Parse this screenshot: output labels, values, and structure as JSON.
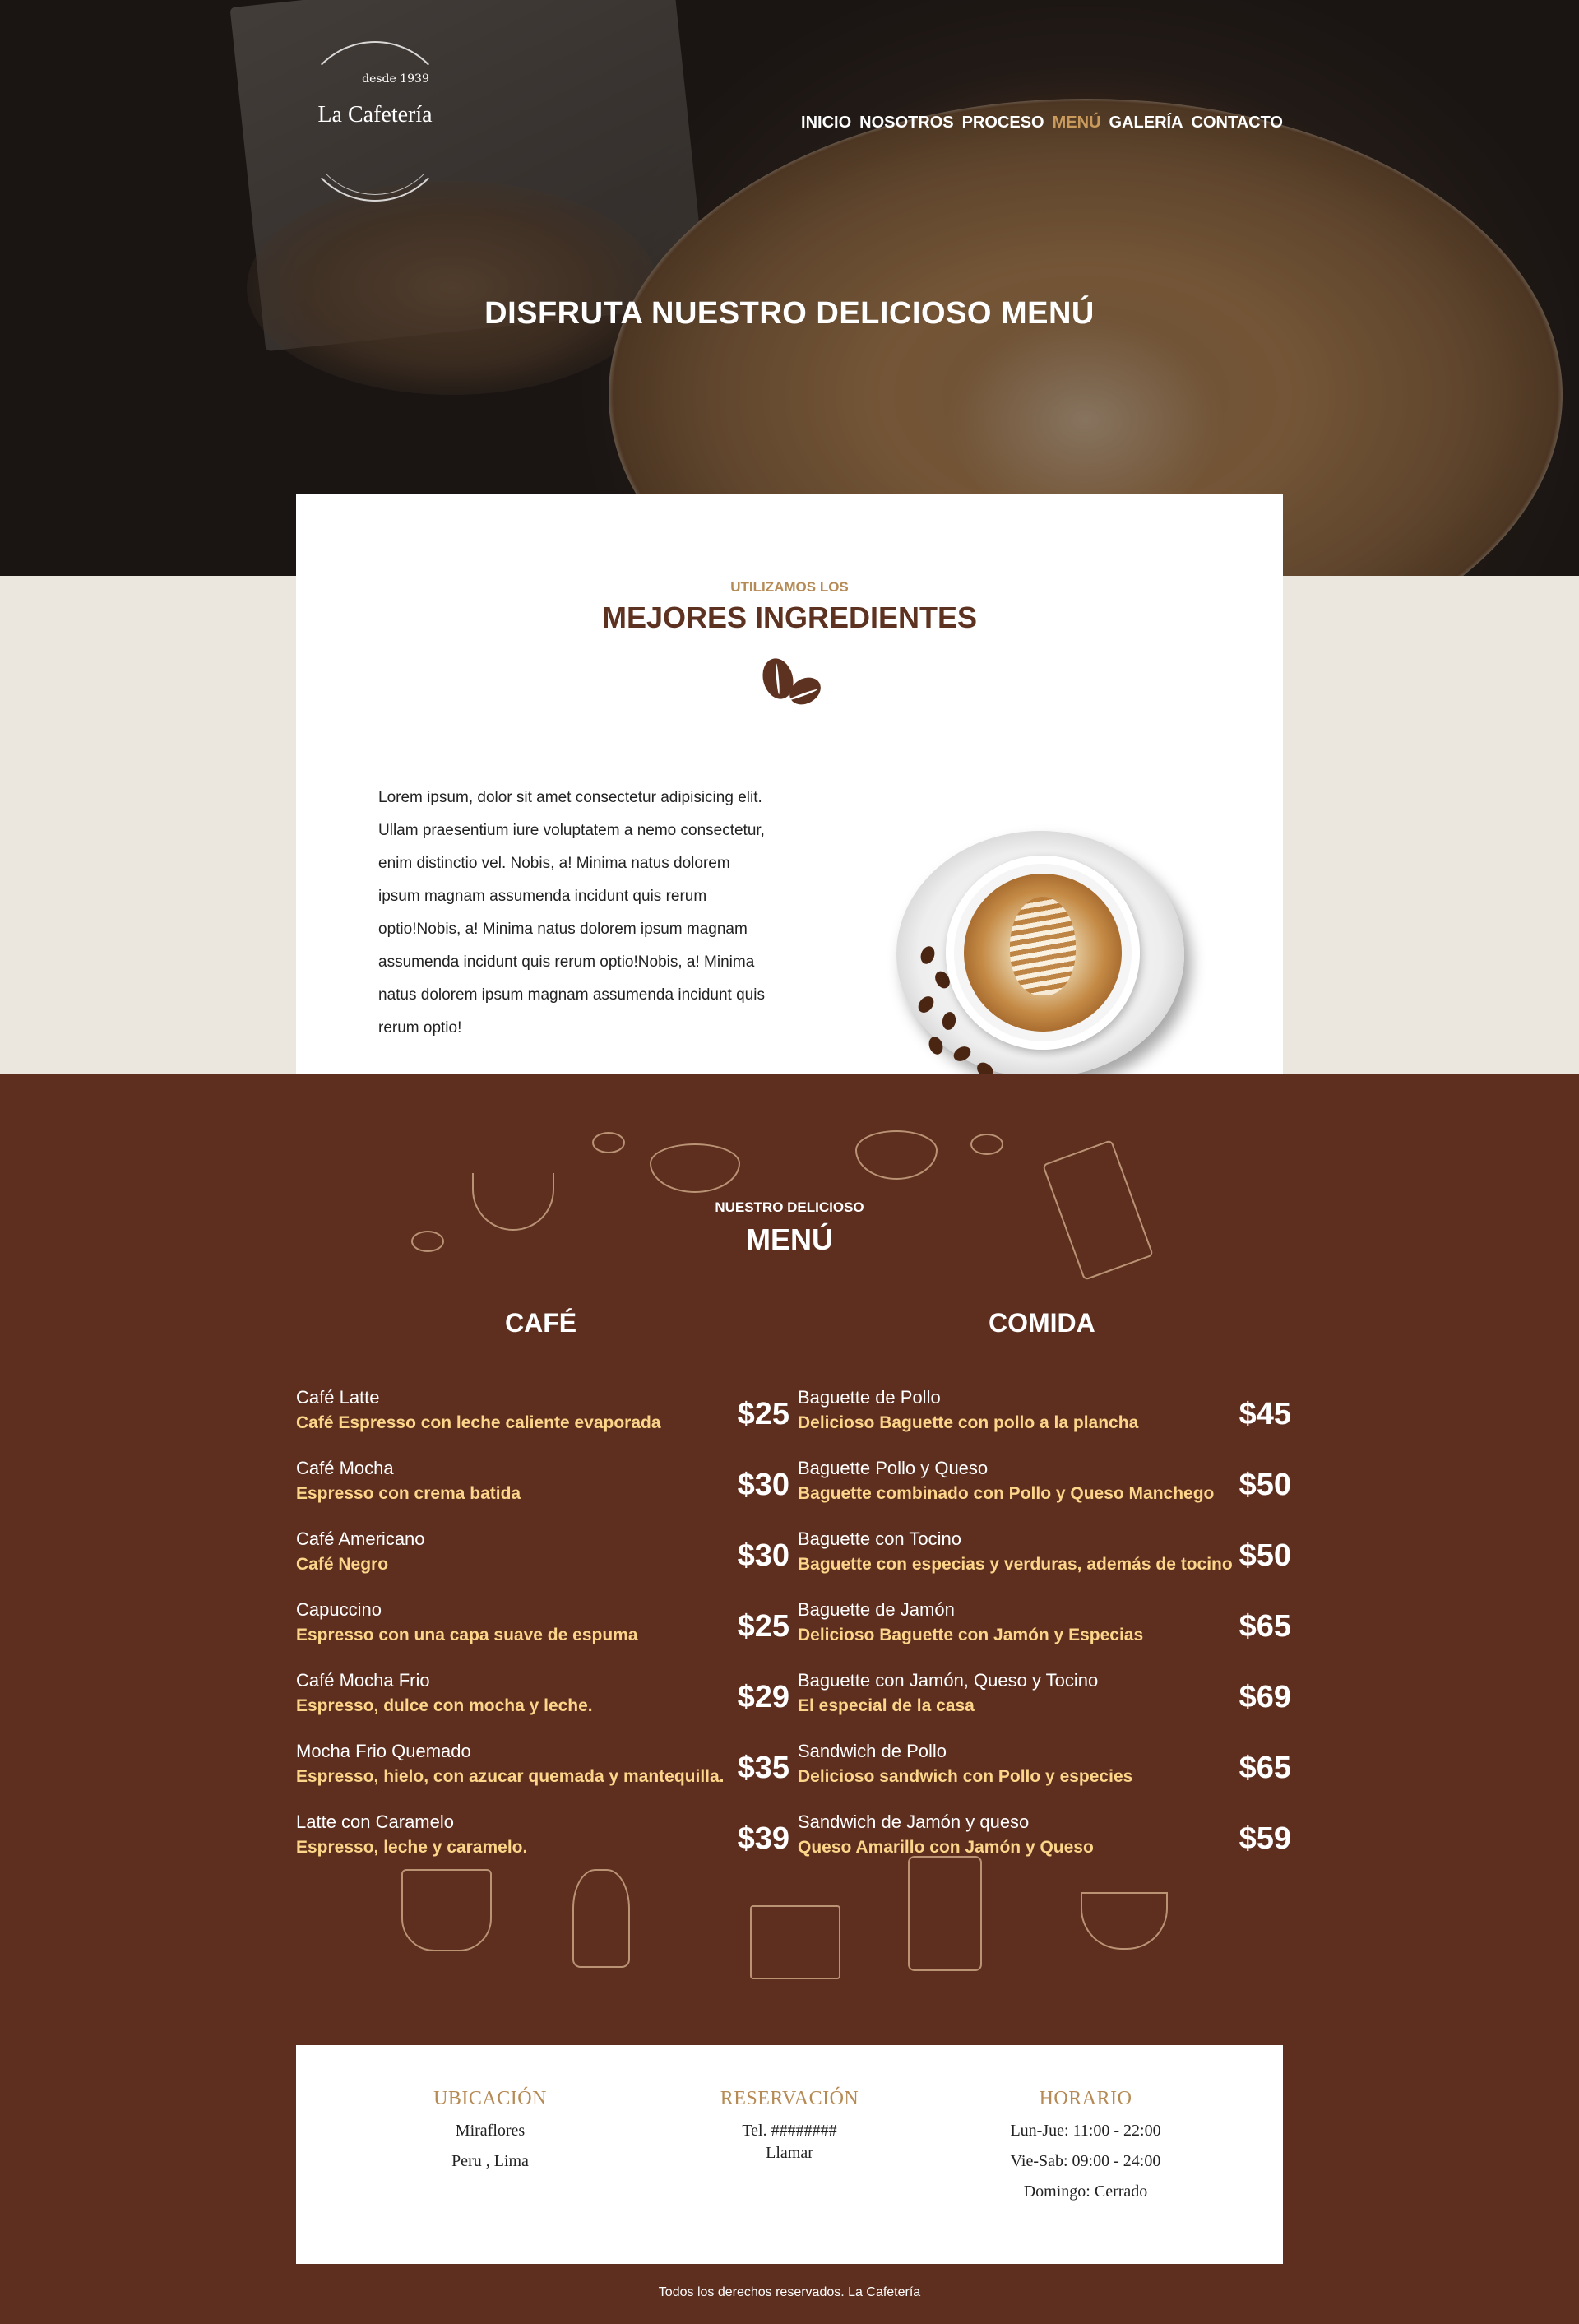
{
  "header": {
    "logo": {
      "since": "desde 1939",
      "name": "La Cafetería"
    },
    "nav": [
      {
        "label": "INICIO"
      },
      {
        "label": "NOSOTROS"
      },
      {
        "label": "PROCESO"
      },
      {
        "label": "MENÚ",
        "active": true
      },
      {
        "label": "GALERÍA"
      },
      {
        "label": "CONTACTO"
      }
    ],
    "title": "DISFRUTA NUESTRO DELICIOSO MENÚ"
  },
  "ingredients": {
    "eyebrow": "UTILIZAMOS LOS",
    "heading": "MEJORES INGREDIENTES",
    "icon": "coffee-beans-icon",
    "text": "Lorem ipsum, dolor sit amet consectetur adipisicing elit. Ullam praesentium iure voluptatem a nemo consectetur, enim distinctio vel. Nobis, a! Minima natus dolorem ipsum magnam assumenda incidunt quis rerum optio!Nobis, a! Minima natus dolorem ipsum magnam assumenda incidunt quis rerum optio!Nobis, a! Minima natus dolorem ipsum magnam assumenda incidunt quis rerum optio!"
  },
  "menu": {
    "eyebrow": "NUESTRO DELICIOSO",
    "heading": "MENÚ",
    "cafe_title": "CAFÉ",
    "comida_title": "COMIDA",
    "cafe": [
      {
        "name": "Café Latte",
        "desc": "Café Espresso con leche caliente evaporada",
        "price": "$25"
      },
      {
        "name": "Café Mocha",
        "desc": "Espresso con crema batida",
        "price": "$30"
      },
      {
        "name": "Café Americano",
        "desc": "Café Negro",
        "price": "$30"
      },
      {
        "name": "Capuccino",
        "desc": "Espresso con una capa suave de espuma",
        "price": "$25"
      },
      {
        "name": "Café Mocha Frio",
        "desc": "Espresso, dulce con mocha y leche.",
        "price": "$29"
      },
      {
        "name": "Mocha Frio Quemado",
        "desc": "Espresso, hielo, con azucar quemada y mantequilla.",
        "price": "$35"
      },
      {
        "name": "Latte con Caramelo",
        "desc": "Espresso, leche y caramelo.",
        "price": "$39"
      }
    ],
    "comida": [
      {
        "name": "Baguette de Pollo",
        "desc": "Delicioso Baguette con pollo a la plancha",
        "price": "$45"
      },
      {
        "name": "Baguette Pollo y Queso",
        "desc": "Baguette combinado con Pollo y Queso Manchego",
        "price": "$50"
      },
      {
        "name": "Baguette con Tocino",
        "desc": "Baguette con especias y verduras, además de tocino",
        "price": "$50"
      },
      {
        "name": "Baguette de Jamón",
        "desc": "Delicioso Baguette con Jamón y Especias",
        "price": "$65"
      },
      {
        "name": "Baguette con Jamón, Queso y Tocino",
        "desc": "El especial de la casa",
        "price": "$69"
      },
      {
        "name": "Sandwich de Pollo",
        "desc": "Delicioso sandwich con Pollo y especies",
        "price": "$65"
      },
      {
        "name": "Sandwich de Jamón y queso",
        "desc": "Queso Amarillo con Jamón y Queso",
        "price": "$59"
      }
    ]
  },
  "info": {
    "ubicacion": {
      "title": "UBICACIÓN",
      "line1": "Miraflores",
      "line2": "Peru , Lima"
    },
    "reservacion": {
      "title": "RESERVACIÓN",
      "line1": "Tel. ########",
      "line2": "Llamar"
    },
    "horario": {
      "title": "HORARIO",
      "line1": "Lun-Jue: 11:00 - 22:00",
      "line2": "Vie-Sab: 09:00 - 24:00",
      "line3": "Domingo: Cerrado"
    }
  },
  "footer": {
    "text": "Todos los derechos reservados. La Cafetería"
  },
  "colors": {
    "brown": "#5e2f1f",
    "gold": "#b58a55",
    "cream": "#fcd58a",
    "beige": "#ebe6de"
  }
}
